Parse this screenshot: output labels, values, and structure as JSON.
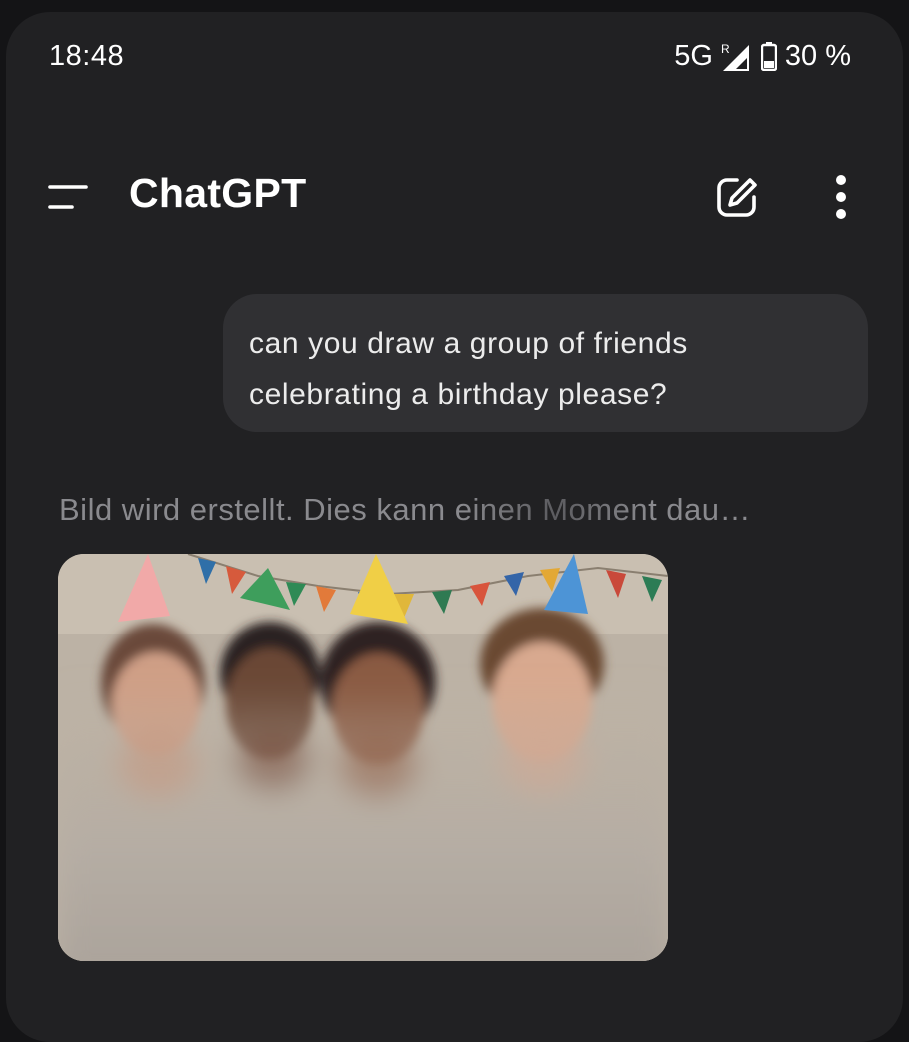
{
  "status_bar": {
    "time": "18:48",
    "network": "5G",
    "signal_roaming_marker": "R",
    "battery": "30 %"
  },
  "app_bar": {
    "title": "ChatGPT",
    "icons": [
      "menu-icon",
      "edit-icon",
      "more-vert-icon"
    ]
  },
  "conversation": {
    "user_message": {
      "line1": "can you draw a group of friends",
      "line2": "celebrating a birthday please?"
    },
    "assistant": {
      "status_text": "Bild wird erstellt. Dies kann einen Moment dau…",
      "image_progress": "partial, blurred preview"
    }
  },
  "colors": {
    "background": "#212123",
    "bubble": "#303033",
    "text": "#ececec",
    "muted_text": "#8a8a8e"
  }
}
